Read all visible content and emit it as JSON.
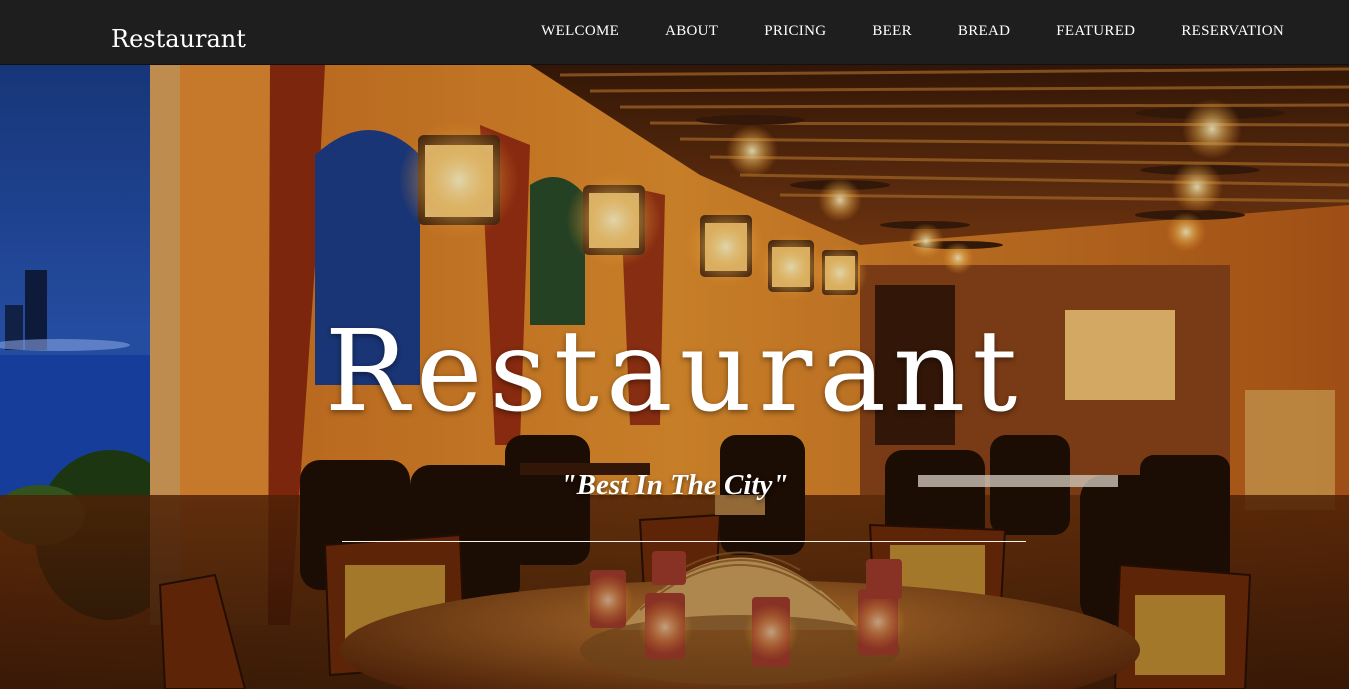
{
  "navbar": {
    "brand": "Restaurant",
    "links": [
      "WELCOME",
      "ABOUT",
      "PRICING",
      "BEER",
      "BREAD",
      "FEATURED",
      "RESERVATION"
    ]
  },
  "hero": {
    "title": "Restaurant",
    "tagline": "\"Best In The City\""
  },
  "colors": {
    "navbar_bg": "#1e1e1e",
    "text": "#ffffff"
  }
}
